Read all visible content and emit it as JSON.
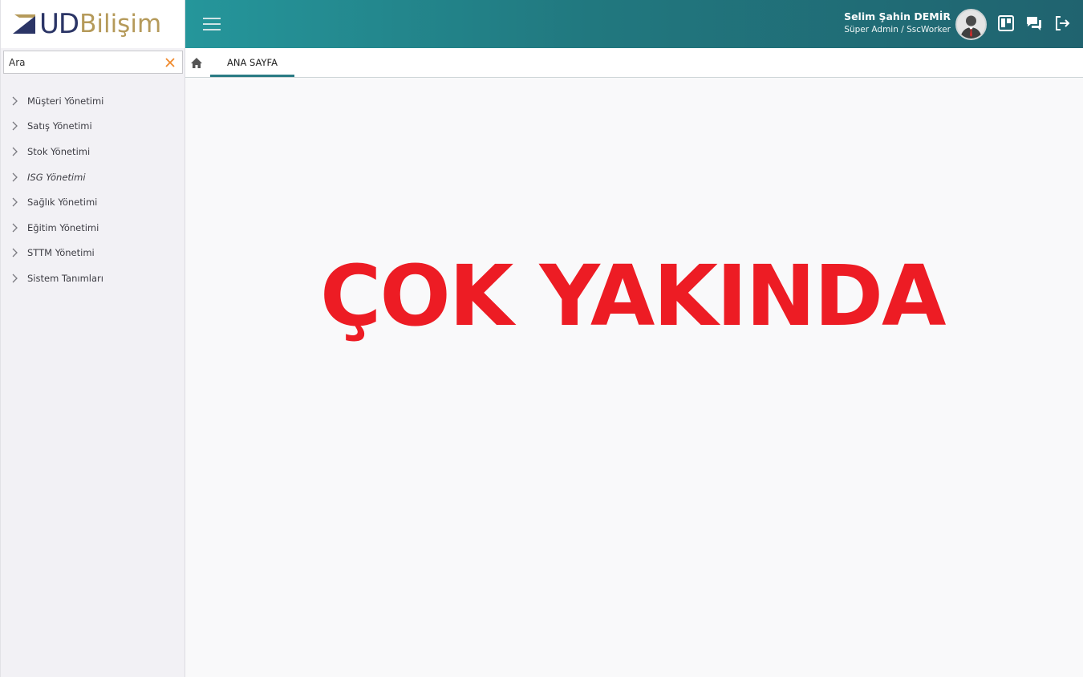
{
  "brand": {
    "logo_ud": "UD",
    "logo_bilisim": "Bilişim",
    "colors": {
      "navy": "#2b3566",
      "gold": "#b59a5a"
    }
  },
  "sidebar": {
    "search": {
      "value": "Ara",
      "clear_icon": "close-icon"
    },
    "items": [
      {
        "label": "Müşteri Yönetimi",
        "italic": false
      },
      {
        "label": "Satış Yönetimi",
        "italic": false
      },
      {
        "label": "Stok Yönetimi",
        "italic": false
      },
      {
        "label": "ISG Yönetimi",
        "italic": true
      },
      {
        "label": "Sağlık Yönetimi",
        "italic": false
      },
      {
        "label": "Eğitim Yönetimi",
        "italic": false
      },
      {
        "label": "STTM Yönetimi",
        "italic": false
      },
      {
        "label": "Sistem Tanımları",
        "italic": false
      }
    ]
  },
  "topbar": {
    "menu_icon": "hamburger-icon",
    "user": {
      "name": "Selim Şahin DEMİR",
      "role": "Süper Admin / SscWorker"
    },
    "icons": [
      "board-icon",
      "chat-icon",
      "logout-icon"
    ],
    "colors": {
      "gradient_start": "#25969b",
      "gradient_end": "#20636f"
    }
  },
  "tabs": {
    "home_icon": "home-icon",
    "items": [
      {
        "label": "ANA SAYFA",
        "active": true
      }
    ],
    "accent": "#2a7b84"
  },
  "main": {
    "message": "ÇOK YAKINDA",
    "message_color": "#ed1c24"
  }
}
